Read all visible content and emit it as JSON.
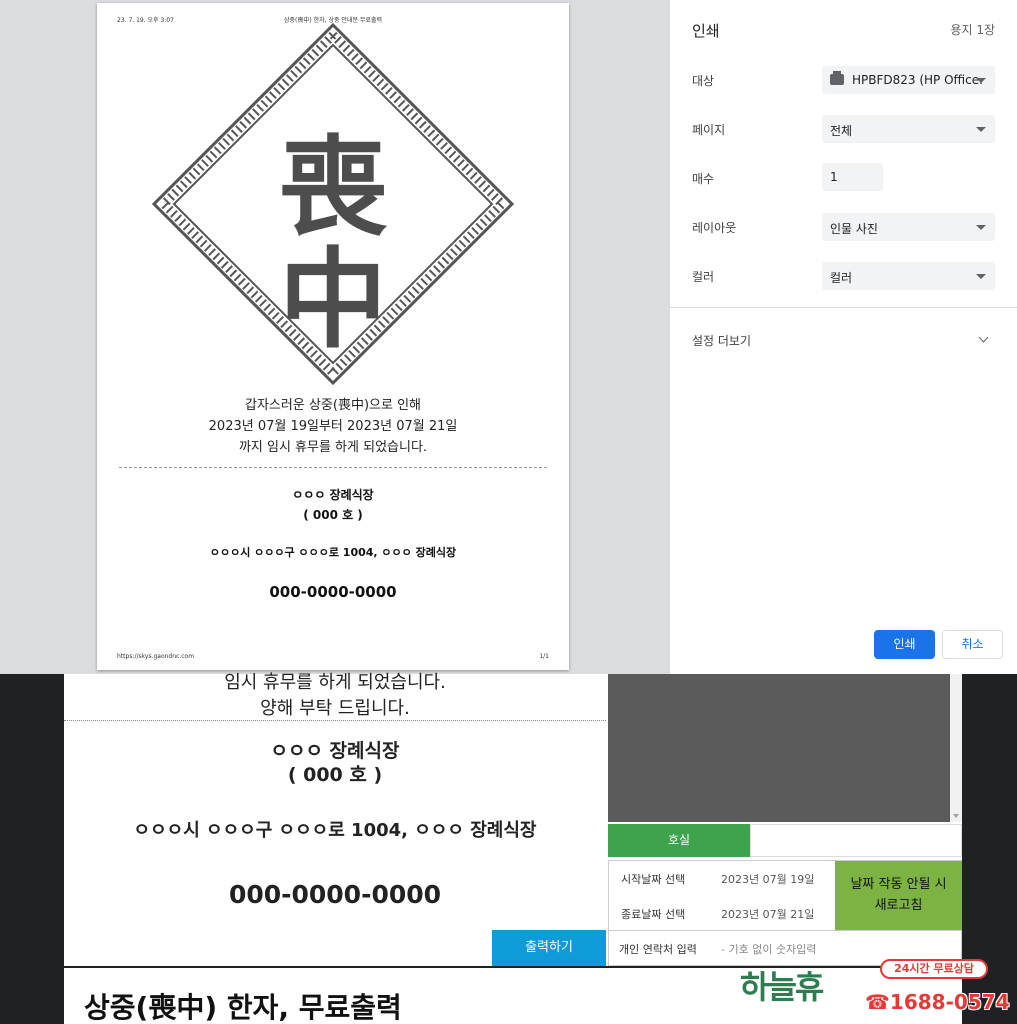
{
  "preview": {
    "header_date": "23. 7. 19. 오후 3:07",
    "header_title": "상중(喪中) 한자, 상중 안내문 무료출력",
    "hanja_top": "喪",
    "hanja_bottom": "中",
    "msg_line1": "갑자스러운 상중(喪中)으로 인해",
    "msg_line2": "2023년 07월 19일부터 2023년 07월 21일",
    "msg_line3": "까지 임시 휴무를 하게 되었습니다.",
    "place_name": "ㅇㅇㅇ 장례식장",
    "room": "( 000 호 )",
    "address": "ㅇㅇㅇ시 ㅇㅇㅇ구 ㅇㅇㅇ로 1004, ㅇㅇㅇ 장례식장",
    "phone": "000-0000-0000",
    "footer_url": "https://skys.gaondnc.com",
    "footer_page": "1/1"
  },
  "panel": {
    "title": "인쇄",
    "sheet_count": "용지 1장",
    "destination_label": "대상",
    "destination_value": "HPBFD823 (HP Office.",
    "pages_label": "페이지",
    "pages_value": "전체",
    "copies_label": "매수",
    "copies_value": "1",
    "layout_label": "레이아웃",
    "layout_value": "인물 사진",
    "color_label": "컬러",
    "color_value": "컬러",
    "more_settings": "설정 더보기",
    "print_button": "인쇄",
    "cancel_button": "취소"
  },
  "background": {
    "line_partial": "임시 휴무를 하게 되었습니다.",
    "line_apology": "양해 부탁 드립니다.",
    "place_name": "ㅇㅇㅇ 장례식장",
    "room": "( 000 호 )",
    "address": "ㅇㅇㅇ시 ㅇㅇㅇ구 ㅇㅇㅇ로 1004, ㅇㅇㅇ 장례식장",
    "phone": "000-0000-0000",
    "room_button": "호실",
    "start_label": "시작날짜 선택",
    "start_value": "2023년 07월 19일",
    "end_label": "종료날짜 선택",
    "end_value": "2023년 07월 21일",
    "refresh_line1": "날짜 작동 안될 시",
    "refresh_line2": "새로고침",
    "output_button": "출력하기",
    "contact_label": "개인 연락처 입력",
    "contact_placeholder": "- 기호 없이 숫자입력",
    "page_title": "상중(喪中) 한자, 무료출력",
    "ad_logo": "하늘휴",
    "ad_badge": "24시간 무료상담",
    "ad_phone": "☎1688-0574"
  },
  "colors": {
    "accent_blue": "#1a73e8",
    "room_green": "#3fa34d",
    "refresh_green": "#7cb342",
    "output_blue": "#0f9bd7",
    "ad_red": "#e53935"
  }
}
